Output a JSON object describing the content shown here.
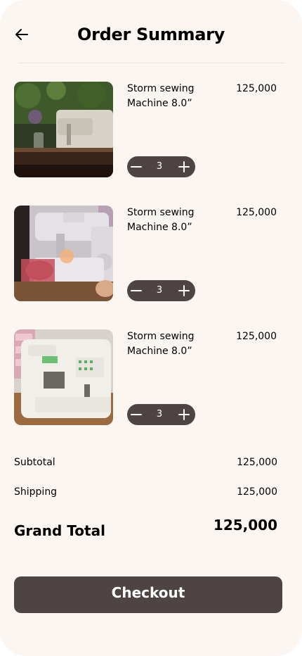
{
  "header": {
    "title": "Order Summary",
    "back_icon": "arrow-left-icon"
  },
  "items": [
    {
      "name": "Storm sewing Machine 8.0”",
      "price": "125,000",
      "quantity": "3",
      "image": "sewing-machine-on-table-photo"
    },
    {
      "name": "Storm sewing Machine 8.0”",
      "price": "125,000",
      "quantity": "3",
      "image": "sewing-machine-in-use-photo"
    },
    {
      "name": "Storm sewing Machine 8.0”",
      "price": "125,000",
      "quantity": "3",
      "image": "white-sewing-machine-photo"
    }
  ],
  "summary": {
    "subtotal_label": "Subtotal",
    "subtotal_value": "125,000",
    "shipping_label": "Shipping",
    "shipping_value": "125,000",
    "grand_total_label": "Grand Total",
    "grand_total_value": "125,000"
  },
  "checkout_label": "Checkout",
  "colors": {
    "background": "#fcf6f3",
    "accent": "#4e4443",
    "text": "#000000"
  }
}
